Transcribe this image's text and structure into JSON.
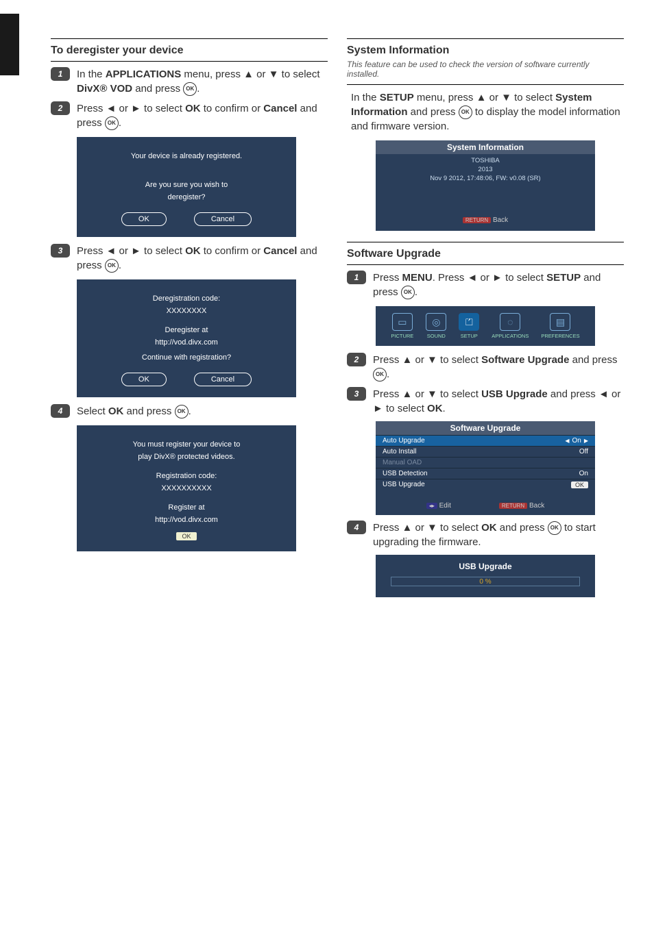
{
  "left": {
    "section_title": "To deregister your device",
    "step1": {
      "pre": "In the ",
      "bold": "APPLICATIONS",
      "mid": " menu, press ▲ or ▼ to select ",
      "bold2": "DivX® VOD",
      "tail": " and press ",
      "tail2": "."
    },
    "step2": {
      "pre": "Press ◄ or ► to select ",
      "bold": "OK",
      "mid": " to confirm or ",
      "bold2": "Cancel",
      "tail": " and press ",
      "tail2": "."
    },
    "box1": {
      "l1": "Your device is already registered.",
      "l2": "Are you sure you wish to",
      "l3": "deregister?",
      "b1": "OK",
      "b2": "Cancel"
    },
    "step3": {
      "pre": "Press ◄ or ► to select ",
      "bold": "OK",
      "mid": " to confirm or ",
      "bold2": "Cancel",
      "tail": " and press ",
      "tail2": "."
    },
    "box2": {
      "l1": "Deregistration code:",
      "l2": "XXXXXXXX",
      "l3": "Deregister at",
      "l4": "http://vod.divx.com",
      "l5": "Continue with registration?",
      "b1": "OK",
      "b2": "Cancel"
    },
    "step4": {
      "pre": "Select ",
      "bold": "OK",
      "tail": " and press ",
      "tail2": "."
    },
    "box3": {
      "l1": "You must register your device to",
      "l2": "play DivX® protected videos.",
      "l3": "Registration code:",
      "l4": "XXXXXXXXXX",
      "l5": "Register at",
      "l6": "http://vod.divx.com",
      "ok": "OK"
    }
  },
  "right": {
    "sec1_title": "System Information",
    "sec1_sub": "This feature can be used to check the version of software currently installed.",
    "sec1_step": {
      "pre": "In the ",
      "bold": "SETUP",
      "mid": " menu, press ▲ or ▼ to select ",
      "bold2": "System Information",
      "tail": " and press ",
      "tail2": " to display the model information and firmware version."
    },
    "info": {
      "title": "System Information",
      "brand": "TOSHIBA",
      "year": "2013",
      "fw": "Nov  9 2012, 17:48:06, FW: v0.08 (SR)",
      "return": "RETURN",
      "back": "Back"
    },
    "sec2_title": "Software Upgrade",
    "step1": {
      "pre": "Press ",
      "bold": "MENU",
      "mid": ". Press ◄ or ► to select ",
      "bold2": "SETUP",
      "tail": " and press ",
      "tail2": "."
    },
    "menu": {
      "m1": "PICTURE",
      "m2": "SOUND",
      "m3": "SETUP",
      "m4": "APPLICATIONS",
      "m5": "PREFERENCES"
    },
    "step2": {
      "pre": "Press ▲ or ▼ to select ",
      "bold": "Software Upgrade",
      "tail": " and press ",
      "tail2": "."
    },
    "step3": {
      "pre": "Press ▲ or ▼ to select ",
      "bold": "USB Upgrade",
      "tail": " and press ◄ or ► to select ",
      "bold2": "OK",
      "tail2": "."
    },
    "table": {
      "title": "Software Upgrade",
      "r1l": "Auto Upgrade",
      "r1v": "On",
      "r2l": "Auto Install",
      "r2v": "Off",
      "r3l": "Manual OAD",
      "r4l": "USB Detection",
      "r4v": "On",
      "r5l": "USB Upgrade",
      "r5v": "OK",
      "edit": "Edit",
      "return": "RETURN",
      "back": "Back"
    },
    "step4": {
      "pre": "Press ▲ or ▼ to select ",
      "bold": "OK",
      "mid": " and press ",
      "tail": " to start upgrading the firmware."
    },
    "usb": {
      "title": "USB Upgrade",
      "pct": "0  %"
    }
  }
}
